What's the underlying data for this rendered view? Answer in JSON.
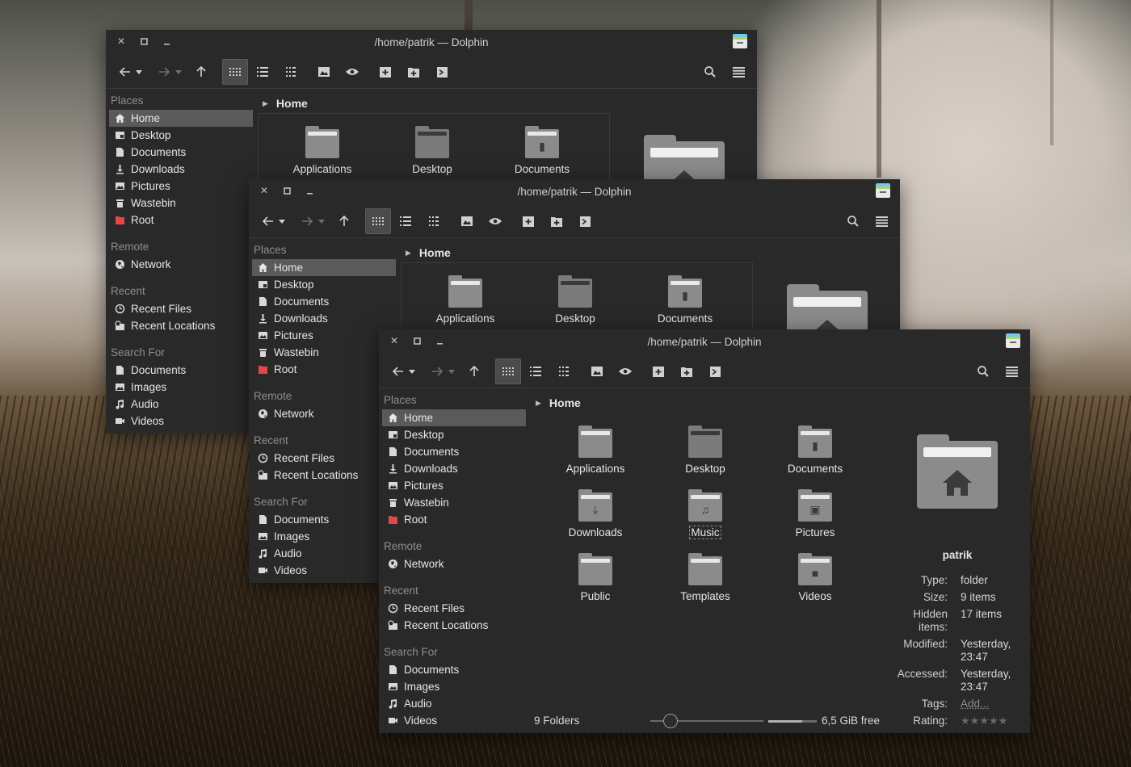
{
  "window": {
    "title": "/home/patrik — Dolphin"
  },
  "breadcrumb": "Home",
  "sidebar": {
    "places_head": "Places",
    "places": [
      {
        "label": "Home",
        "icon": "home-icon"
      },
      {
        "label": "Desktop",
        "icon": "desktop-icon"
      },
      {
        "label": "Documents",
        "icon": "document-icon"
      },
      {
        "label": "Downloads",
        "icon": "download-icon"
      },
      {
        "label": "Pictures",
        "icon": "picture-icon"
      },
      {
        "label": "Wastebin",
        "icon": "trash-icon"
      },
      {
        "label": "Root",
        "icon": "root-folder-icon"
      }
    ],
    "remote_head": "Remote",
    "remote": [
      {
        "label": "Network",
        "icon": "network-icon"
      }
    ],
    "recent_head": "Recent",
    "recent": [
      {
        "label": "Recent Files",
        "icon": "clock-icon"
      },
      {
        "label": "Recent Locations",
        "icon": "recent-location-icon"
      }
    ],
    "search_head": "Search For",
    "search": [
      {
        "label": "Documents",
        "icon": "document-icon"
      },
      {
        "label": "Images",
        "icon": "image-icon"
      },
      {
        "label": "Audio",
        "icon": "audio-icon"
      },
      {
        "label": "Videos",
        "icon": "video-icon"
      }
    ]
  },
  "folders": [
    {
      "label": "Applications",
      "glyph": ""
    },
    {
      "label": "Desktop",
      "glyph": ""
    },
    {
      "label": "Documents",
      "glyph": "▮"
    },
    {
      "label": "Downloads",
      "glyph": "⤓"
    },
    {
      "label": "Music",
      "glyph": "♫"
    },
    {
      "label": "Pictures",
      "glyph": "▣"
    },
    {
      "label": "Public",
      "glyph": ""
    },
    {
      "label": "Templates",
      "glyph": ""
    },
    {
      "label": "Videos",
      "glyph": "■"
    }
  ],
  "info": {
    "name": "patrik",
    "type_k": "Type:",
    "type_v": "folder",
    "size_k": "Size:",
    "size_v": "9 items",
    "hidden_k": "Hidden items:",
    "hidden_v": "17 items",
    "modified_k": "Modified:",
    "modified_v": "Yesterday, 23:47",
    "accessed_k": "Accessed:",
    "accessed_v": "Yesterday, 23:47",
    "tags_k": "Tags:",
    "tags_v": "Add...",
    "rating_k": "Rating:",
    "rating_v": 0
  },
  "status": {
    "folders": "9 Folders",
    "free": "6,5 GiB free",
    "zoom_fraction": 0.17,
    "used_fraction": 0.7
  },
  "colors": {
    "window_bg": "#2a2929",
    "selection": "#5a5a5a",
    "root_icon": "#e2474c"
  }
}
